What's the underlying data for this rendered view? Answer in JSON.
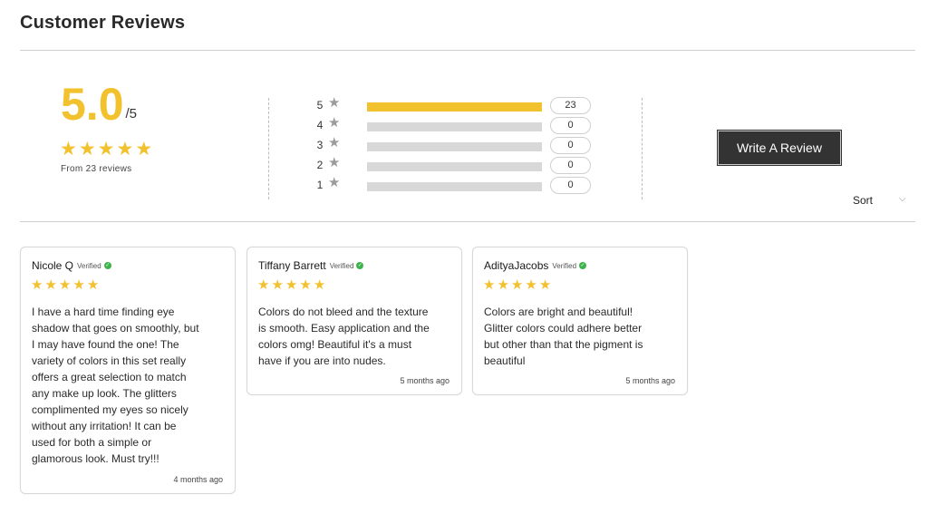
{
  "header": {
    "title": "Customer Reviews"
  },
  "summary": {
    "score": "5.0",
    "max": "/5",
    "stars": 5,
    "count_text": "From 23 reviews"
  },
  "histogram": [
    {
      "rating": "5",
      "count": "23",
      "fraction": 1.0
    },
    {
      "rating": "4",
      "count": "0",
      "fraction": 0
    },
    {
      "rating": "3",
      "count": "0",
      "fraction": 0
    },
    {
      "rating": "2",
      "count": "0",
      "fraction": 0
    },
    {
      "rating": "1",
      "count": "0",
      "fraction": 0
    }
  ],
  "actions": {
    "write_review": "Write A Review",
    "sort_label": "Sort"
  },
  "reviews": [
    {
      "name": "Nicole Q",
      "verified": "Verified",
      "rating": 5,
      "body_lines": [
        "I have a hard time finding eye",
        "shadow that goes on smoothly, but",
        "I may have found the one! The",
        "variety of colors in this set really",
        "offers a great selection to match",
        "any make up look. The glitters",
        "complimented my eyes so nicely",
        "without any irritation! It can be",
        "used for both a simple or",
        "glamorous look. Must try!!!"
      ],
      "time": "4 months ago"
    },
    {
      "name": "Tiffany Barrett",
      "verified": "Verified",
      "rating": 5,
      "body_lines": [
        "Colors do not bleed and the texture",
        "is smooth. Easy application and the",
        "colors omg! Beautiful it's a must",
        "have if you are into nudes."
      ],
      "time": "5 months ago"
    },
    {
      "name": "AdityaJacobs",
      "verified": "Verified",
      "rating": 5,
      "body_lines": [
        "Colors are bright and beautiful!",
        "Glitter colors could adhere better",
        "but other than that the pigment is",
        "beautiful"
      ],
      "time": "5 months ago"
    }
  ],
  "colors": {
    "accent": "#f2c12e",
    "button": "#333333",
    "verified": "#3cb44b"
  },
  "icons": {
    "star": "star-icon",
    "check": "verified-check-icon",
    "chevron": "chevron-down-icon"
  }
}
